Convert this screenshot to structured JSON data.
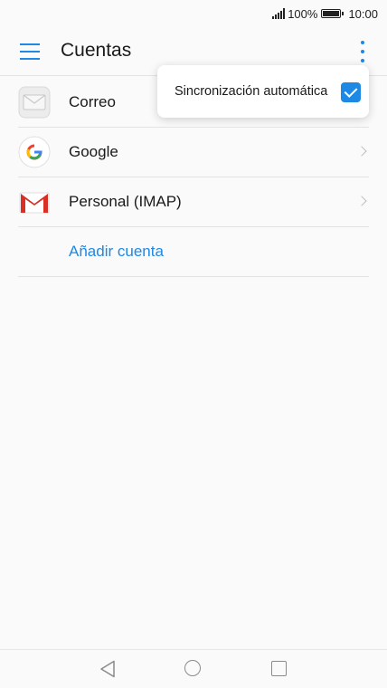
{
  "status_bar": {
    "battery": "100%",
    "time": "10:00",
    "icons": [
      "signal-icon",
      "battery-icon"
    ]
  },
  "app_bar": {
    "title": "Cuentas",
    "icons": [
      "menu-icon",
      "overflow-menu-icon"
    ]
  },
  "accounts": {
    "items": [
      {
        "label": "Correo",
        "icon": "mail-envelope-icon"
      },
      {
        "label": "Google",
        "icon": "google-icon"
      },
      {
        "label": "Personal (IMAP)",
        "icon": "gmail-icon"
      }
    ],
    "add_label": "Añadir cuenta"
  },
  "popup_menu": {
    "sync_label": "Sincronización automática",
    "sync_checked": true
  },
  "nav_bar": {
    "icons": [
      "back-icon",
      "home-icon",
      "recents-icon"
    ]
  },
  "colors": {
    "accent": "#1e88e5",
    "background": "#fafafa",
    "divider": "#e3e3e3"
  }
}
